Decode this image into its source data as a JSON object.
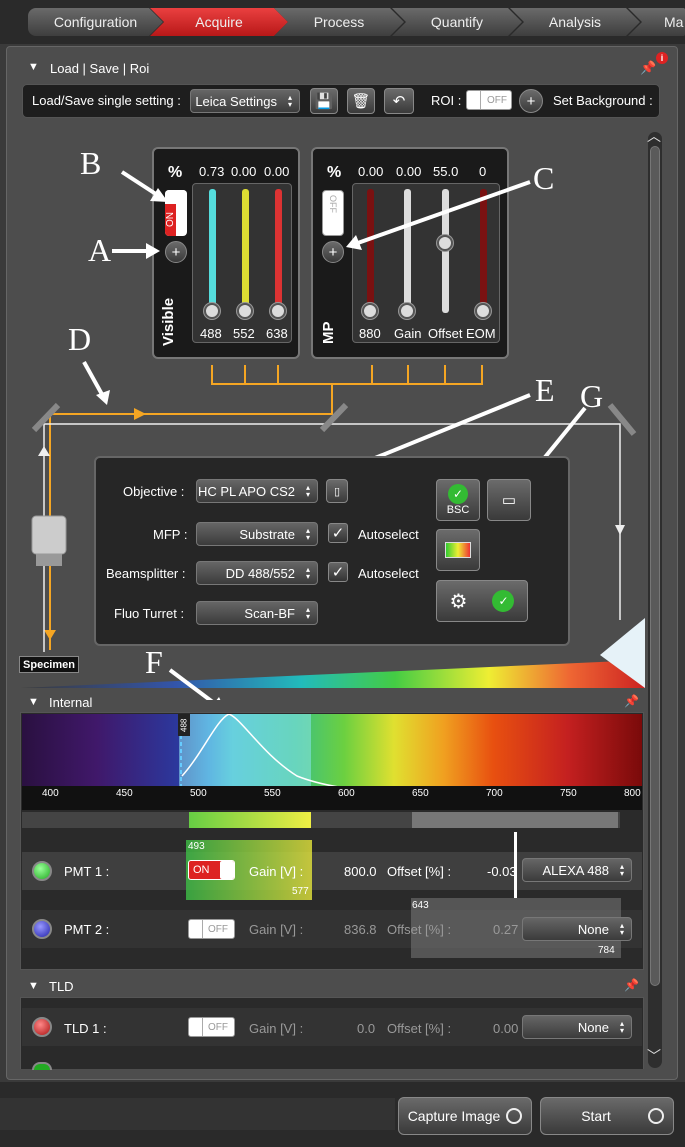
{
  "tabs": [
    "Configuration",
    "Acquire",
    "Process",
    "Quantify",
    "Analysis",
    "Ma"
  ],
  "load_section": {
    "title": "Load | Save | Roi",
    "load_label": "Load/Save single setting :",
    "setting_value": "Leica Settings",
    "roi_label": "ROI :",
    "roi_state": "OFF",
    "set_bg_label": "Set Background :"
  },
  "lasers": {
    "pct": "%",
    "values": [
      "0.73",
      "0.00",
      "0.00"
    ],
    "wavelengths": [
      "488",
      "552",
      "638"
    ],
    "switch": "ON",
    "vertical_label": "Visible",
    "levels": [
      0,
      0,
      0
    ]
  },
  "mp": {
    "pct": "%",
    "values": [
      "0.00",
      "0.00",
      "55.0",
      "0"
    ],
    "labels": [
      "880",
      "Gain",
      "Offset",
      "EOM"
    ],
    "switch": "OFF",
    "vertical_label": "MP",
    "levels": [
      0,
      0,
      0.55,
      0
    ]
  },
  "beam": {
    "specimen": "Specimen",
    "objective_label": "Objective :",
    "objective_value": "HC PL APO CS2",
    "mfp_label": "MFP :",
    "mfp_value": "Substrate",
    "autoselect1": "Autoselect",
    "beamsplitter_label": "Beamsplitter :",
    "beamsplitter_value": "DD 488/552",
    "autoselect2": "Autoselect",
    "fluo_label": "Fluo Turret :",
    "fluo_value": "Scan-BF",
    "bsc": "BSC"
  },
  "annotations": {
    "A": "A",
    "B": "B",
    "C": "C",
    "D": "D",
    "E": "E",
    "F": "F",
    "G": "G"
  },
  "internal": {
    "title": "Internal",
    "laser_mark": "488",
    "ticks": [
      "400",
      "450",
      "500",
      "550",
      "600",
      "650",
      "700",
      "750",
      "800"
    ],
    "pmt1": {
      "label": "PMT 1 :",
      "state": "ON",
      "gain_label": "Gain [V] :",
      "gain": "800.0",
      "offset_label": "Offset [%] :",
      "offset": "-0.03",
      "dye": "ALEXA 488",
      "range_lo": "493",
      "range_hi": "577"
    },
    "pmt2": {
      "label": "PMT 2 :",
      "state": "OFF",
      "gain_label": "Gain [V] :",
      "gain": "836.8",
      "offset_label": "Offset [%] :",
      "offset": "0.27",
      "dye": "None",
      "range_lo": "643",
      "range_hi": "784"
    }
  },
  "tld": {
    "title": "TLD",
    "tld1": {
      "label": "TLD 1 :",
      "state": "OFF",
      "gain_label": "Gain [V] :",
      "gain": "0.0",
      "offset_label": "Offset [%] :",
      "offset": "0.00",
      "dye": "None"
    }
  },
  "bottom": {
    "capture": "Capture Image",
    "start": "Start"
  },
  "colors": {
    "active_tab": "#d62a2a",
    "accent_orange": "#f5a623"
  }
}
